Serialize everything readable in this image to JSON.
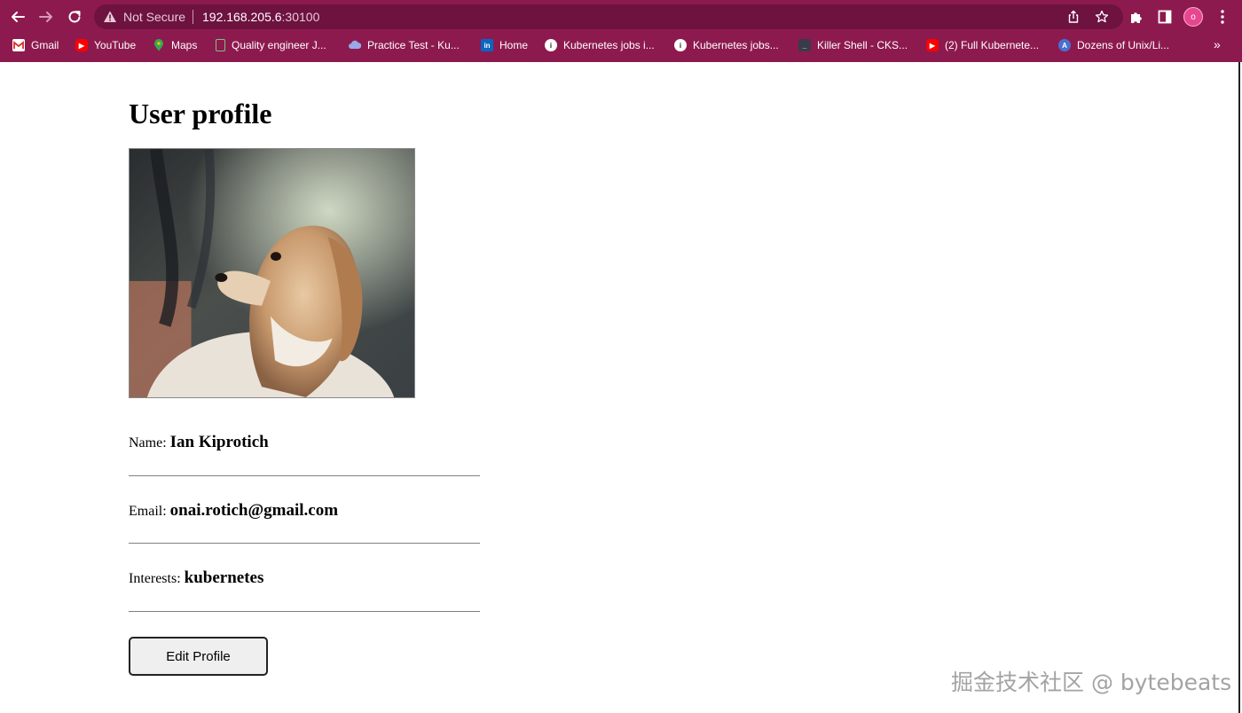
{
  "browser": {
    "security_label": "Not Secure",
    "url_host": "192.168.205.6",
    "url_port": ":30100",
    "profile_initial": "o",
    "colors": {
      "chrome": "#8d1a4e",
      "omnibox": "#6e1240"
    }
  },
  "bookmarks": [
    {
      "label": "Gmail",
      "icon": "gmail-icon"
    },
    {
      "label": "YouTube",
      "icon": "youtube-icon"
    },
    {
      "label": "Maps",
      "icon": "maps-icon"
    },
    {
      "label": "Quality engineer J...",
      "icon": "page-icon"
    },
    {
      "label": "Practice Test - Ku...",
      "icon": "kodekloud-icon"
    },
    {
      "label": "Home",
      "icon": "linkedin-icon"
    },
    {
      "label": "Kubernetes jobs i...",
      "icon": "info-icon"
    },
    {
      "label": "Kubernetes jobs...",
      "icon": "info-icon"
    },
    {
      "label": "Killer Shell - CKS...",
      "icon": "terminal-icon"
    },
    {
      "label": "(2) Full Kubernete...",
      "icon": "youtube-icon"
    },
    {
      "label": "Dozens of Unix/Li...",
      "icon": "site-a-icon"
    }
  ],
  "bookmarks_overflow": "»",
  "profile": {
    "title": "User profile",
    "photo": "dog-photo",
    "name_label": "Name:",
    "name_value": "Ian Kiprotich",
    "email_label": "Email:",
    "email_value": "onai.rotich@gmail.com",
    "interests_label": "Interests:",
    "interests_value": "kubernetes",
    "edit_button": "Edit Profile"
  },
  "watermark": "掘金技术社区 @ bytebeats"
}
